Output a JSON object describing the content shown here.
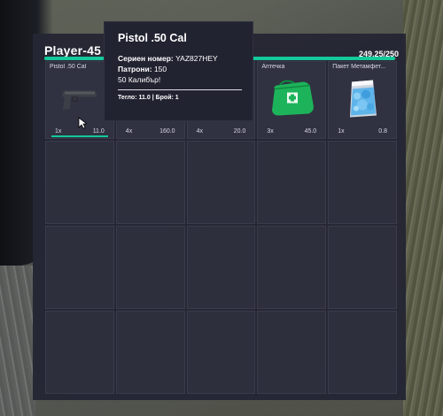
{
  "inventory": {
    "player_name": "Player-45",
    "weight_text": "249.25/250",
    "weight_fraction": 0.997,
    "accent_color": "#14c99a",
    "slots": [
      {
        "label": "Pistol .50 Cal",
        "qty": "1x",
        "weight": "11.0",
        "icon": "pistol-icon"
      },
      {
        "label": "",
        "qty": "4x",
        "weight": "160.0",
        "icon": "weapon-icon"
      },
      {
        "label": "",
        "qty": "4x",
        "weight": "20.0",
        "icon": "item-icon"
      },
      {
        "label": "Аптечка",
        "qty": "3x",
        "weight": "45.0",
        "icon": "medkit-icon"
      },
      {
        "label": "Пакет Метамфет...",
        "qty": "1x",
        "weight": "0.8",
        "icon": "meth-bag-icon"
      }
    ]
  },
  "tooltip": {
    "title": "Pistol .50 Cal",
    "serial_label": "Сериен номер:",
    "serial_value": "YAZ827HEY",
    "ammo_label": "Патрони:",
    "ammo_value": "150",
    "caliber": "50 Калибър!",
    "weight_label": "Тегло:",
    "weight_value": "11.0",
    "count_label": "Брой:",
    "count_value": "1"
  }
}
